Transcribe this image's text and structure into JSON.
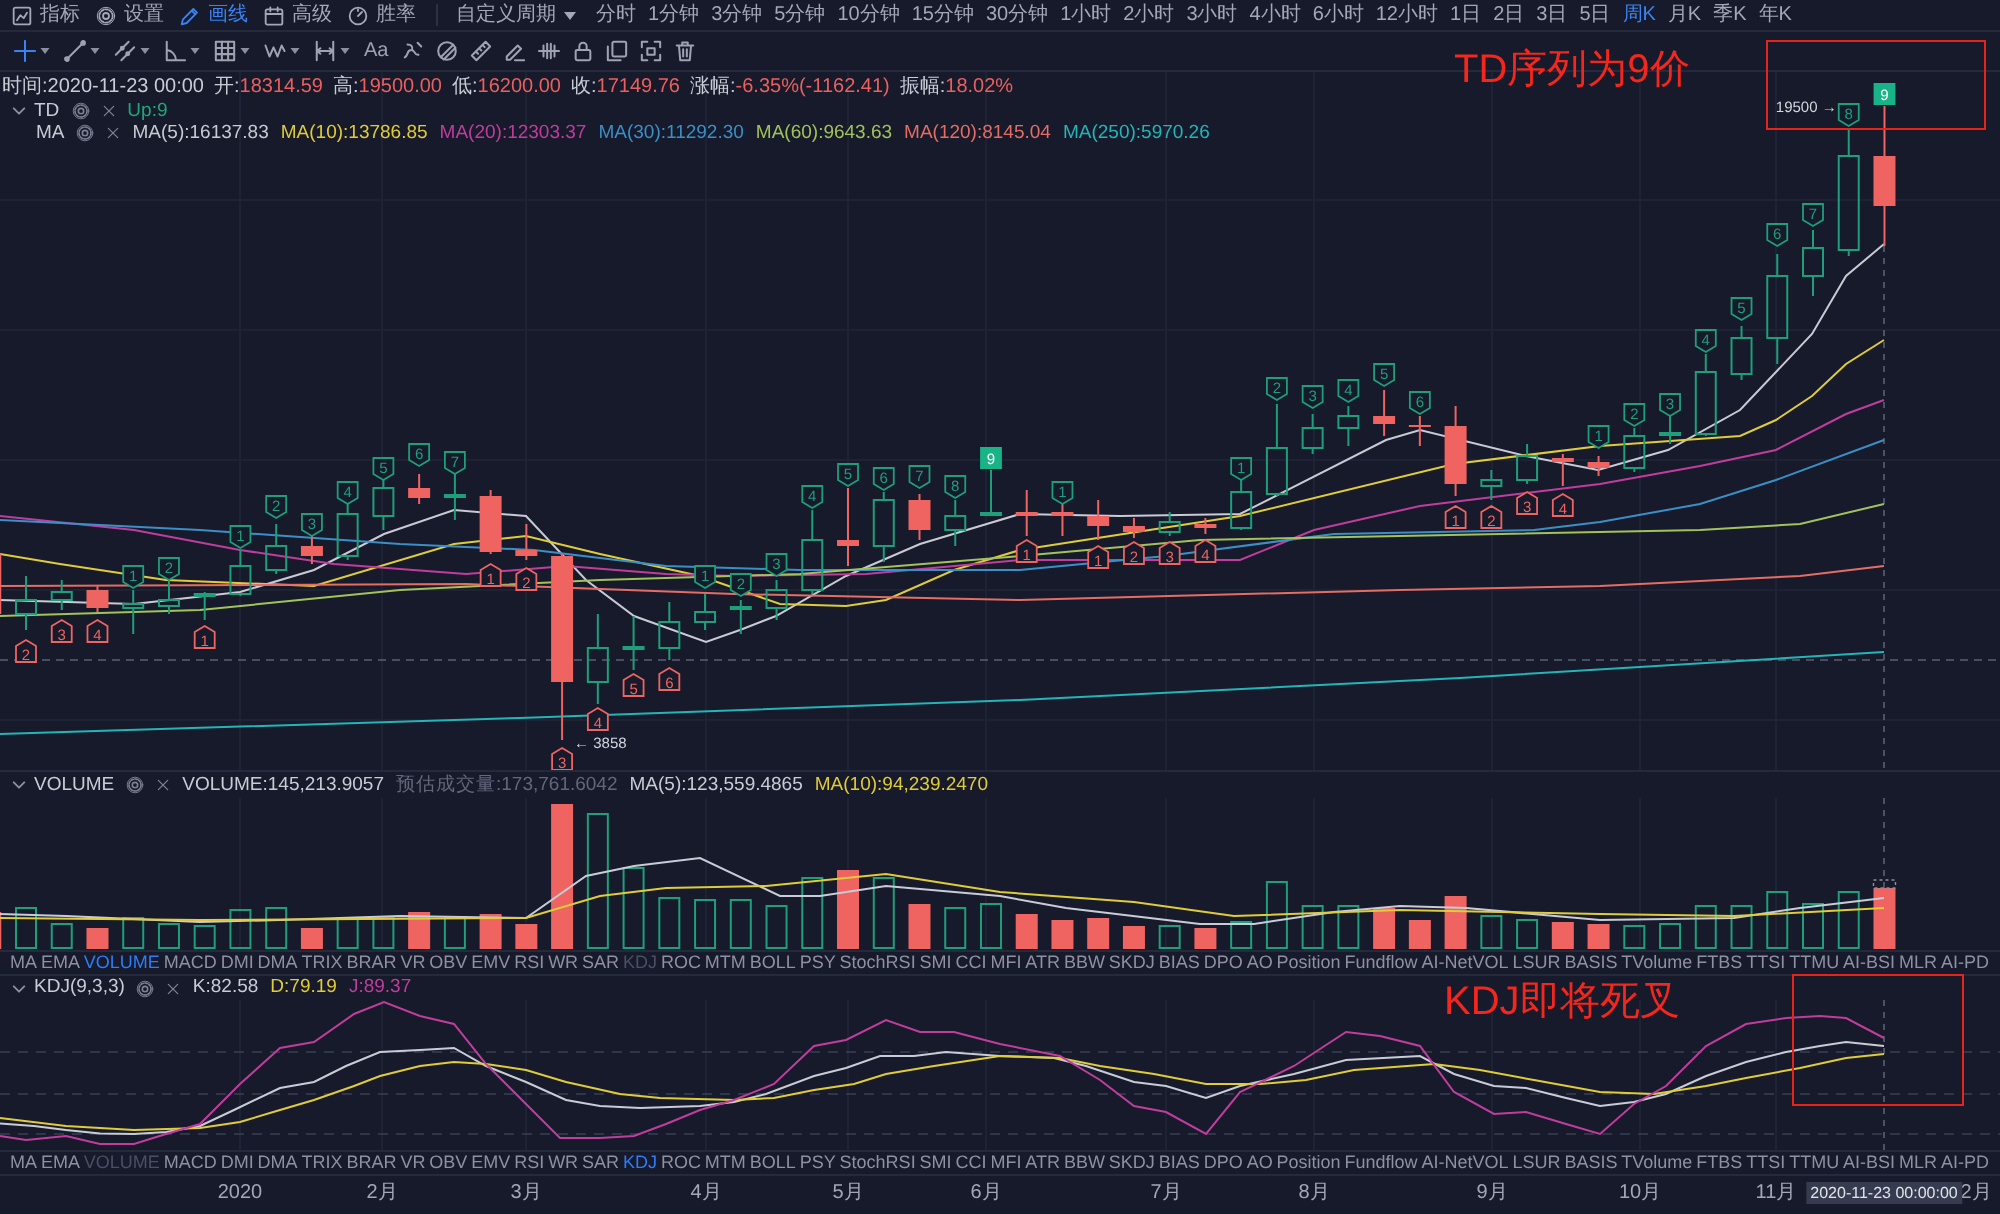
{
  "menu": [
    {
      "label": "指标",
      "selected": false
    },
    {
      "label": "设置",
      "selected": false
    },
    {
      "label": "画线",
      "selected": true
    },
    {
      "label": "高级",
      "selected": false
    },
    {
      "label": "胜率",
      "selected": false
    }
  ],
  "period_menu": {
    "label": "自定义周期"
  },
  "periods": [
    {
      "label": "分时",
      "selected": false
    },
    {
      "label": "1分钟",
      "selected": false
    },
    {
      "label": "3分钟",
      "selected": false
    },
    {
      "label": "5分钟",
      "selected": false
    },
    {
      "label": "10分钟",
      "selected": false
    },
    {
      "label": "15分钟",
      "selected": false
    },
    {
      "label": "30分钟",
      "selected": false
    },
    {
      "label": "1小时",
      "selected": false
    },
    {
      "label": "2小时",
      "selected": false
    },
    {
      "label": "3小时",
      "selected": false
    },
    {
      "label": "4小时",
      "selected": false
    },
    {
      "label": "6小时",
      "selected": false
    },
    {
      "label": "12小时",
      "selected": false
    },
    {
      "label": "1日",
      "selected": false
    },
    {
      "label": "2日",
      "selected": false
    },
    {
      "label": "3日",
      "selected": false
    },
    {
      "label": "5日",
      "selected": false
    },
    {
      "label": "周K",
      "selected": true
    },
    {
      "label": "月K",
      "selected": false
    },
    {
      "label": "季K",
      "selected": false
    },
    {
      "label": "年K",
      "selected": false
    }
  ],
  "drawing_tools": [
    {
      "kind": "crosshair",
      "selected": true,
      "has_menu": true
    },
    {
      "kind": "line",
      "selected": false,
      "has_menu": true
    },
    {
      "kind": "parallel",
      "selected": false,
      "has_menu": true
    },
    {
      "kind": "angle",
      "selected": false,
      "has_menu": true
    },
    {
      "kind": "grid",
      "selected": false,
      "has_menu": true
    },
    {
      "kind": "wave",
      "selected": false,
      "has_menu": true
    },
    {
      "kind": "range",
      "selected": false,
      "has_menu": true
    },
    {
      "kind": "text",
      "label": "Aa",
      "selected": false,
      "has_menu": false
    },
    {
      "kind": "squiggle",
      "selected": false,
      "has_menu": false
    },
    {
      "kind": "circle_slash",
      "selected": false,
      "has_menu": false
    },
    {
      "kind": "ruler",
      "selected": false,
      "has_menu": false
    },
    {
      "kind": "pen",
      "selected": false,
      "has_menu": false
    },
    {
      "kind": "ticks",
      "selected": false,
      "has_menu": false
    },
    {
      "kind": "lock",
      "selected": false,
      "has_menu": false
    },
    {
      "kind": "copy",
      "selected": false,
      "has_menu": false
    },
    {
      "kind": "screenshot",
      "selected": false,
      "has_menu": false
    },
    {
      "kind": "trash",
      "selected": false,
      "has_menu": false
    }
  ],
  "main_chart": {
    "ohlc": [
      {
        "label": "时间:",
        "value": "2020-11-23 00:00",
        "color": "#c9ccd6"
      },
      {
        "label": "开:",
        "value": "18314.59",
        "color": "#e9605c"
      },
      {
        "label": "高:",
        "value": "19500.00",
        "color": "#e9605c"
      },
      {
        "label": "低:",
        "value": "16200.00",
        "color": "#e9605c"
      },
      {
        "label": "收:",
        "value": "17149.76",
        "color": "#e9605c"
      },
      {
        "label": "涨幅:",
        "value": "-6.35%(-1162.41)",
        "color": "#e9605c"
      },
      {
        "label": "振幅:",
        "value": "18.02%",
        "color": "#e9605c"
      }
    ],
    "legends": [
      {
        "name": "TD",
        "expanded": true,
        "values": [
          {
            "text": "Up:9",
            "color": "#1fa67a"
          }
        ]
      },
      {
        "name": "MA",
        "values": [
          {
            "text": "MA(5):16137.83",
            "color": "#c9cad3"
          },
          {
            "text": "MA(10):13786.85",
            "color": "#e0cc38"
          },
          {
            "text": "MA(20):12303.37",
            "color": "#c13d9d"
          },
          {
            "text": "MA(30):11292.30",
            "color": "#3b8fc7"
          },
          {
            "text": "MA(60):9643.63",
            "color": "#a2c25a"
          },
          {
            "text": "MA(120):8145.04",
            "color": "#e56d63"
          },
          {
            "text": "MA(250):5970.26",
            "color": "#23b5b7"
          }
        ]
      }
    ],
    "td_marks": [
      {
        "label": "2",
        "kind": "down"
      },
      {
        "label": "3",
        "kind": "down"
      },
      {
        "label": "4",
        "kind": "down"
      },
      {
        "label": "1",
        "kind": "up"
      },
      {
        "label": "2",
        "kind": "up"
      },
      {
        "label": "1",
        "kind": "down"
      },
      {
        "label": "1",
        "kind": "up"
      },
      {
        "label": "2",
        "kind": "up"
      },
      {
        "label": "3",
        "kind": "up"
      },
      {
        "label": "4",
        "kind": "up"
      },
      {
        "label": "5",
        "kind": "up"
      },
      {
        "label": "6",
        "kind": "up"
      },
      {
        "label": "7",
        "kind": "up"
      },
      {
        "label": "1",
        "kind": "down"
      },
      {
        "label": "2",
        "kind": "down"
      },
      {
        "label": "3",
        "kind": "down"
      },
      {
        "label": "4",
        "kind": "down"
      },
      {
        "label": "5",
        "kind": "down"
      },
      {
        "label": "6",
        "kind": "down"
      },
      {
        "label": "1",
        "kind": "up"
      },
      {
        "label": "2",
        "kind": "up"
      },
      {
        "label": "3",
        "kind": "up"
      },
      {
        "label": "4",
        "kind": "up"
      },
      {
        "label": "5",
        "kind": "up"
      },
      {
        "label": "6",
        "kind": "up"
      },
      {
        "label": "7",
        "kind": "up"
      },
      {
        "label": "8",
        "kind": "up"
      },
      {
        "label": "9",
        "kind": "complete"
      },
      {
        "label": "1",
        "kind": "down"
      },
      {
        "label": "1",
        "kind": "up"
      },
      {
        "label": "1",
        "kind": "down"
      },
      {
        "label": "2",
        "kind": "down"
      },
      {
        "label": "3",
        "kind": "down"
      },
      {
        "label": "4",
        "kind": "down"
      },
      {
        "label": "1",
        "kind": "up"
      },
      {
        "label": "2",
        "kind": "up"
      },
      {
        "label": "3",
        "kind": "up"
      },
      {
        "label": "4",
        "kind": "up"
      },
      {
        "label": "5",
        "kind": "up"
      },
      {
        "label": "6",
        "kind": "up"
      },
      {
        "label": "1",
        "kind": "down"
      },
      {
        "label": "2",
        "kind": "down"
      },
      {
        "label": "3",
        "kind": "down"
      },
      {
        "label": "4",
        "kind": "down"
      },
      {
        "label": "1",
        "kind": "up"
      },
      {
        "label": "2",
        "kind": "up"
      },
      {
        "label": "3",
        "kind": "up"
      },
      {
        "label": "4",
        "kind": "up"
      },
      {
        "label": "5",
        "kind": "up"
      },
      {
        "label": "6",
        "kind": "up"
      },
      {
        "label": "7",
        "kind": "up"
      },
      {
        "label": "8",
        "kind": "up"
      },
      {
        "label": "9",
        "kind": "complete"
      }
    ],
    "high_label": "19500 →",
    "low_label": "← 3858"
  },
  "volume_pane": {
    "legend": {
      "name": "VOLUME",
      "expanded": true,
      "values": [
        {
          "text": "VOLUME:145,213.9057",
          "color": "#c9ccd6"
        },
        {
          "text": "预估成交量:173,761.6042",
          "color": "#62677a"
        },
        {
          "text": "MA(5):123,559.4865",
          "color": "#c9ccd6"
        },
        {
          "text": "MA(10):94,239.2470",
          "color": "#e0cc38"
        }
      ]
    }
  },
  "indicator_tabs_volume": [
    {
      "label": "MA",
      "selected": false,
      "disabled": false
    },
    {
      "label": "EMA",
      "selected": false,
      "disabled": false
    },
    {
      "label": "VOLUME",
      "selected": true,
      "disabled": false
    },
    {
      "label": "MACD",
      "selected": false,
      "disabled": false
    },
    {
      "label": "DMI",
      "selected": false,
      "disabled": false
    },
    {
      "label": "DMA",
      "selected": false,
      "disabled": false
    },
    {
      "label": "TRIX",
      "selected": false,
      "disabled": false
    },
    {
      "label": "BRAR",
      "selected": false,
      "disabled": false
    },
    {
      "label": "VR",
      "selected": false,
      "disabled": false
    },
    {
      "label": "OBV",
      "selected": false,
      "disabled": false
    },
    {
      "label": "EMV",
      "selected": false,
      "disabled": false
    },
    {
      "label": "RSI",
      "selected": false,
      "disabled": false
    },
    {
      "label": "WR",
      "selected": false,
      "disabled": false
    },
    {
      "label": "SAR",
      "selected": false,
      "disabled": false
    },
    {
      "label": "KDJ",
      "selected": false,
      "disabled": true
    },
    {
      "label": "ROC",
      "selected": false,
      "disabled": false
    },
    {
      "label": "MTM",
      "selected": false,
      "disabled": false
    },
    {
      "label": "BOLL",
      "selected": false,
      "disabled": false
    },
    {
      "label": "PSY",
      "selected": false,
      "disabled": false
    },
    {
      "label": "StochRSI",
      "selected": false,
      "disabled": false
    },
    {
      "label": "SMI",
      "selected": false,
      "disabled": false
    },
    {
      "label": "CCI",
      "selected": false,
      "disabled": false
    },
    {
      "label": "MFI",
      "selected": false,
      "disabled": false
    },
    {
      "label": "ATR",
      "selected": false,
      "disabled": false
    },
    {
      "label": "BBW",
      "selected": false,
      "disabled": false
    },
    {
      "label": "SKDJ",
      "selected": false,
      "disabled": false
    },
    {
      "label": "BIAS",
      "selected": false,
      "disabled": false
    },
    {
      "label": "DPO",
      "selected": false,
      "disabled": false
    },
    {
      "label": "AO",
      "selected": false,
      "disabled": false
    },
    {
      "label": "Position",
      "selected": false,
      "disabled": false
    },
    {
      "label": "Fundflow",
      "selected": false,
      "disabled": false
    },
    {
      "label": "AI-NetVOL",
      "selected": false,
      "disabled": false
    },
    {
      "label": "LSUR",
      "selected": false,
      "disabled": false
    },
    {
      "label": "BASIS",
      "selected": false,
      "disabled": false
    },
    {
      "label": "TVolume",
      "selected": false,
      "disabled": false
    },
    {
      "label": "FTBS",
      "selected": false,
      "disabled": false
    },
    {
      "label": "TTSI",
      "selected": false,
      "disabled": false
    },
    {
      "label": "TTMU",
      "selected": false,
      "disabled": false
    },
    {
      "label": "AI-BSI",
      "selected": false,
      "disabled": false
    },
    {
      "label": "MLR",
      "selected": false,
      "disabled": false
    },
    {
      "label": "AI-PD",
      "selected": false,
      "disabled": false
    }
  ],
  "kdj_pane": {
    "legend": {
      "name": "KDJ(9,3,3)",
      "expanded": true,
      "values": [
        {
          "text": "K:82.58",
          "color": "#c9ccd6"
        },
        {
          "text": "D:79.19",
          "color": "#e0cc38"
        },
        {
          "text": "J:89.37",
          "color": "#c13d9d"
        }
      ]
    }
  },
  "indicator_tabs_kdj": [
    {
      "label": "MA",
      "selected": false,
      "disabled": false
    },
    {
      "label": "EMA",
      "selected": false,
      "disabled": false
    },
    {
      "label": "VOLUME",
      "selected": false,
      "disabled": true
    },
    {
      "label": "MACD",
      "selected": false,
      "disabled": false
    },
    {
      "label": "DMI",
      "selected": false,
      "disabled": false
    },
    {
      "label": "DMA",
      "selected": false,
      "disabled": false
    },
    {
      "label": "TRIX",
      "selected": false,
      "disabled": false
    },
    {
      "label": "BRAR",
      "selected": false,
      "disabled": false
    },
    {
      "label": "VR",
      "selected": false,
      "disabled": false
    },
    {
      "label": "OBV",
      "selected": false,
      "disabled": false
    },
    {
      "label": "EMV",
      "selected": false,
      "disabled": false
    },
    {
      "label": "RSI",
      "selected": false,
      "disabled": false
    },
    {
      "label": "WR",
      "selected": false,
      "disabled": false
    },
    {
      "label": "SAR",
      "selected": false,
      "disabled": false
    },
    {
      "label": "KDJ",
      "selected": true,
      "disabled": false
    },
    {
      "label": "ROC",
      "selected": false,
      "disabled": false
    },
    {
      "label": "MTM",
      "selected": false,
      "disabled": false
    },
    {
      "label": "BOLL",
      "selected": false,
      "disabled": false
    },
    {
      "label": "PSY",
      "selected": false,
      "disabled": false
    },
    {
      "label": "StochRSI",
      "selected": false,
      "disabled": false
    },
    {
      "label": "SMI",
      "selected": false,
      "disabled": false
    },
    {
      "label": "CCI",
      "selected": false,
      "disabled": false
    },
    {
      "label": "MFI",
      "selected": false,
      "disabled": false
    },
    {
      "label": "ATR",
      "selected": false,
      "disabled": false
    },
    {
      "label": "BBW",
      "selected": false,
      "disabled": false
    },
    {
      "label": "SKDJ",
      "selected": false,
      "disabled": false
    },
    {
      "label": "BIAS",
      "selected": false,
      "disabled": false
    },
    {
      "label": "DPO",
      "selected": false,
      "disabled": false
    },
    {
      "label": "AO",
      "selected": false,
      "disabled": false
    },
    {
      "label": "Position",
      "selected": false,
      "disabled": false
    },
    {
      "label": "Fundflow",
      "selected": false,
      "disabled": false
    },
    {
      "label": "AI-NetVOL",
      "selected": false,
      "disabled": false
    },
    {
      "label": "LSUR",
      "selected": false,
      "disabled": false
    },
    {
      "label": "BASIS",
      "selected": false,
      "disabled": false
    },
    {
      "label": "TVolume",
      "selected": false,
      "disabled": false
    },
    {
      "label": "FTBS",
      "selected": false,
      "disabled": false
    },
    {
      "label": "TTSI",
      "selected": false,
      "disabled": false
    },
    {
      "label": "TTMU",
      "selected": false,
      "disabled": false
    },
    {
      "label": "AI-BSI",
      "selected": false,
      "disabled": false
    },
    {
      "label": "MLR",
      "selected": false,
      "disabled": false
    },
    {
      "label": "AI-PD",
      "selected": false,
      "disabled": false
    }
  ],
  "x_axis": {
    "labels": [
      "2020",
      "2月",
      "3月",
      "4月",
      "5月",
      "6月",
      "7月",
      "8月",
      "9月",
      "10月",
      "11月",
      "2月"
    ],
    "crosshair_label": "2020-11-23 00:00:00"
  },
  "annotations": [
    {
      "text": "TD序列为9价"
    },
    {
      "text": "KDJ即将死叉"
    }
  ]
}
